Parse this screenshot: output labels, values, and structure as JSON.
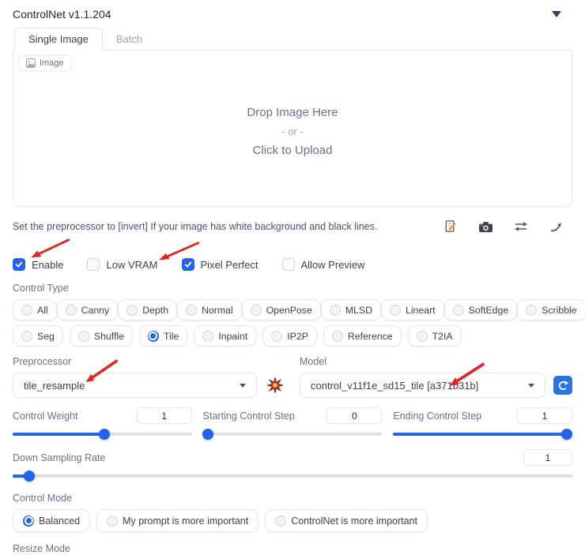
{
  "header": {
    "title": "ControlNet v1.1.204",
    "collapse_icon": "▼"
  },
  "tabs": [
    {
      "label": "Single Image",
      "active": true
    },
    {
      "label": "Batch",
      "active": false
    }
  ],
  "image_panel": {
    "badge_label": "Image",
    "drop_line1": "Drop Image Here",
    "drop_line2": "- or -",
    "drop_line3": "Click to Upload"
  },
  "hint": "Set the preprocessor to [invert] If your image has white background and black lines.",
  "toolbar_icons": [
    {
      "name": "new-canvas-icon",
      "glyph": "📝"
    },
    {
      "name": "webcam-icon",
      "glyph": "📷"
    },
    {
      "name": "mirror-webcam-icon",
      "glyph": "⇄"
    },
    {
      "name": "send-dimensions-icon",
      "glyph": "↗"
    }
  ],
  "checkboxes": [
    {
      "label": "Enable",
      "checked": true
    },
    {
      "label": "Low VRAM",
      "checked": false
    },
    {
      "label": "Pixel Perfect",
      "checked": true
    },
    {
      "label": "Allow Preview",
      "checked": false
    }
  ],
  "control_type": {
    "label": "Control Type",
    "row1": [
      "All",
      "Canny",
      "Depth",
      "Normal",
      "OpenPose",
      "MLSD",
      "Lineart",
      "SoftEdge",
      "Scribble"
    ],
    "row2": [
      "Seg",
      "Shuffle",
      "Tile",
      "Inpaint",
      "IP2P",
      "Reference",
      "T2IA"
    ],
    "selected": "Tile"
  },
  "preprocessor": {
    "label": "Preprocessor",
    "value": "tile_resample",
    "run_icon": "💥"
  },
  "model": {
    "label": "Model",
    "value": "control_v11f1e_sd15_tile [a371b31b]",
    "refresh_icon": "🔄"
  },
  "sliders": [
    {
      "label": "Control Weight",
      "value": "1",
      "percent": 51
    },
    {
      "label": "Starting Control Step",
      "value": "0",
      "percent": 3
    },
    {
      "label": "Ending Control Step",
      "value": "1",
      "percent": 97
    }
  ],
  "down_sampling": {
    "label": "Down Sampling Rate",
    "value": "1",
    "percent": 3
  },
  "control_mode": {
    "label": "Control Mode",
    "options": [
      "Balanced",
      "My prompt is more important",
      "ControlNet is more important"
    ],
    "selected": "Balanced"
  },
  "resize_mode_label": "Resize Mode",
  "colors": {
    "accent": "#2563eb",
    "arrow": "#e02424",
    "border": "#e5e7eb"
  }
}
